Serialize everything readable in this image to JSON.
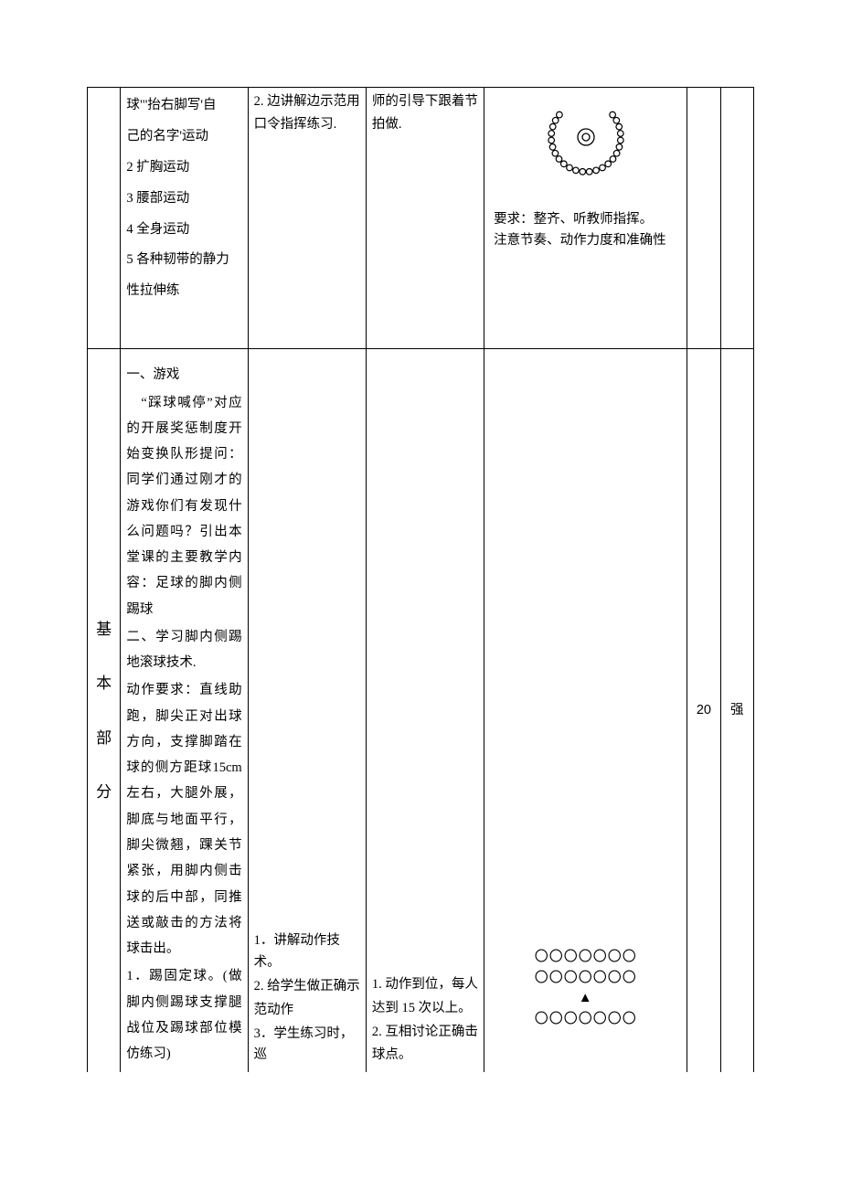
{
  "row1": {
    "col1": {
      "line1": "球\"'抬右脚写'自",
      "line2": "己的名字'运动",
      "line3": "2 扩胸运动",
      "line4": "3 腰部运动",
      "line5": "4 全身运动",
      "line6": "5 各种韧带的静力",
      "line7": "性拉伸练"
    },
    "col2": {
      "line1": "2. 边讲解边示范用",
      "line2": "口令指挥练习."
    },
    "col3": {
      "line1": "师的引导下跟着节",
      "line2": "拍做."
    },
    "col4": {
      "req1": "要求：整齐、听教师指挥。",
      "req2": "注意节奏、动作力度和准确性"
    }
  },
  "row2": {
    "vlabel": {
      "c1": "基",
      "c2": "本",
      "c3": "部",
      "c4": "分"
    },
    "col1": {
      "p1": "一、游戏",
      "p2": "　“踩球喊停”对应的开展奖惩制度开始变换队形提问：同学们通过刚才的游戏你们有发现什么问题吗？引出本堂课的主要教学内容：足球的脚内侧踢球",
      "p3": "二、学习脚内侧踢地滚球技术.",
      "p4": "动作要求：直线助跑，脚尖正对出球方向，支撑脚踏在球的侧方距球15cm 左右，大腿外展，脚底与地面平行，脚尖微翘，踝关节紧张，用脚内侧击球的后中部，同推送或敲击的方法将球击出。",
      "p5": "1．踢固定球。(做脚内侧踢球支撑腿战位及踢球部位模仿练习)"
    },
    "col2": {
      "line1": "1．讲解动作技术。",
      "line2": "2. 给学生做正确示",
      "line3": "范动作",
      "line4": "3．学生练习时，巡"
    },
    "col3": {
      "line1": "1. 动作到位，每人",
      "line2": "达到 15 次以上。",
      "line3": "2. 互相讨论正确击",
      "line4": "球点。"
    },
    "col4": {
      "formation1": "〇〇〇〇〇〇〇",
      "formation2": "〇〇〇〇〇〇〇",
      "formation3": "▲",
      "formation4": "〇〇〇〇〇〇〇"
    },
    "time": "20",
    "intensity": "强"
  }
}
